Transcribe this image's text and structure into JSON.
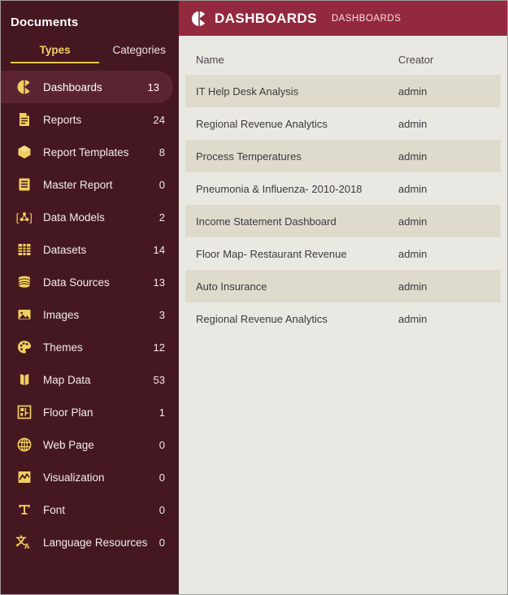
{
  "sidebar": {
    "title": "Documents",
    "tabs": [
      {
        "label": "Types",
        "active": true,
        "name": "tab-types"
      },
      {
        "label": "Categories",
        "active": false,
        "name": "tab-categories"
      }
    ],
    "items": [
      {
        "label": "Dashboards",
        "count": "13",
        "icon": "pie-chart-icon",
        "active": true
      },
      {
        "label": "Reports",
        "count": "24",
        "icon": "document-icon",
        "active": false
      },
      {
        "label": "Report Templates",
        "count": "8",
        "icon": "box-icon",
        "active": false
      },
      {
        "label": "Master Report",
        "count": "0",
        "icon": "master-document-icon",
        "active": false
      },
      {
        "label": "Data Models",
        "count": "2",
        "icon": "data-model-icon",
        "active": false
      },
      {
        "label": "Datasets",
        "count": "14",
        "icon": "grid-table-icon",
        "active": false
      },
      {
        "label": "Data Sources",
        "count": "13",
        "icon": "database-icon",
        "active": false
      },
      {
        "label": "Images",
        "count": "3",
        "icon": "image-icon",
        "active": false
      },
      {
        "label": "Themes",
        "count": "12",
        "icon": "palette-icon",
        "active": false
      },
      {
        "label": "Map Data",
        "count": "53",
        "icon": "map-icon",
        "active": false
      },
      {
        "label": "Floor Plan",
        "count": "1",
        "icon": "floor-plan-icon",
        "active": false
      },
      {
        "label": "Web Page",
        "count": "0",
        "icon": "globe-icon",
        "active": false
      },
      {
        "label": "Visualization",
        "count": "0",
        "icon": "line-chart-icon",
        "active": false
      },
      {
        "label": "Font",
        "count": "0",
        "icon": "font-icon",
        "active": false
      },
      {
        "label": "Language Resources",
        "count": "0",
        "icon": "translate-icon",
        "active": false
      }
    ]
  },
  "header": {
    "icon": "pie-chart-icon",
    "title": "DASHBOARDS",
    "breadcrumb": "DASHBOARDS"
  },
  "table": {
    "columns": [
      "Name",
      "Creator"
    ],
    "rows": [
      {
        "name": "IT Help Desk Analysis",
        "creator": "admin"
      },
      {
        "name": "Regional Revenue Analytics",
        "creator": "admin"
      },
      {
        "name": "Process Temperatures",
        "creator": "admin"
      },
      {
        "name": "Pneumonia & Influenza- 2010-2018",
        "creator": "admin"
      },
      {
        "name": "Income Statement Dashboard",
        "creator": "admin"
      },
      {
        "name": "Floor Map- Restaurant Revenue",
        "creator": "admin"
      },
      {
        "name": "Auto Insurance",
        "creator": "admin"
      },
      {
        "name": "Regional Revenue Analytics",
        "creator": "admin"
      }
    ]
  },
  "colors": {
    "sidebar_bg": "#451821",
    "sidebar_active": "#5c2430",
    "header_bg": "#93293f",
    "accent_gold": "#f0cf5f",
    "row_odd": "#dedbcd",
    "row_even": "#eae8e2"
  }
}
